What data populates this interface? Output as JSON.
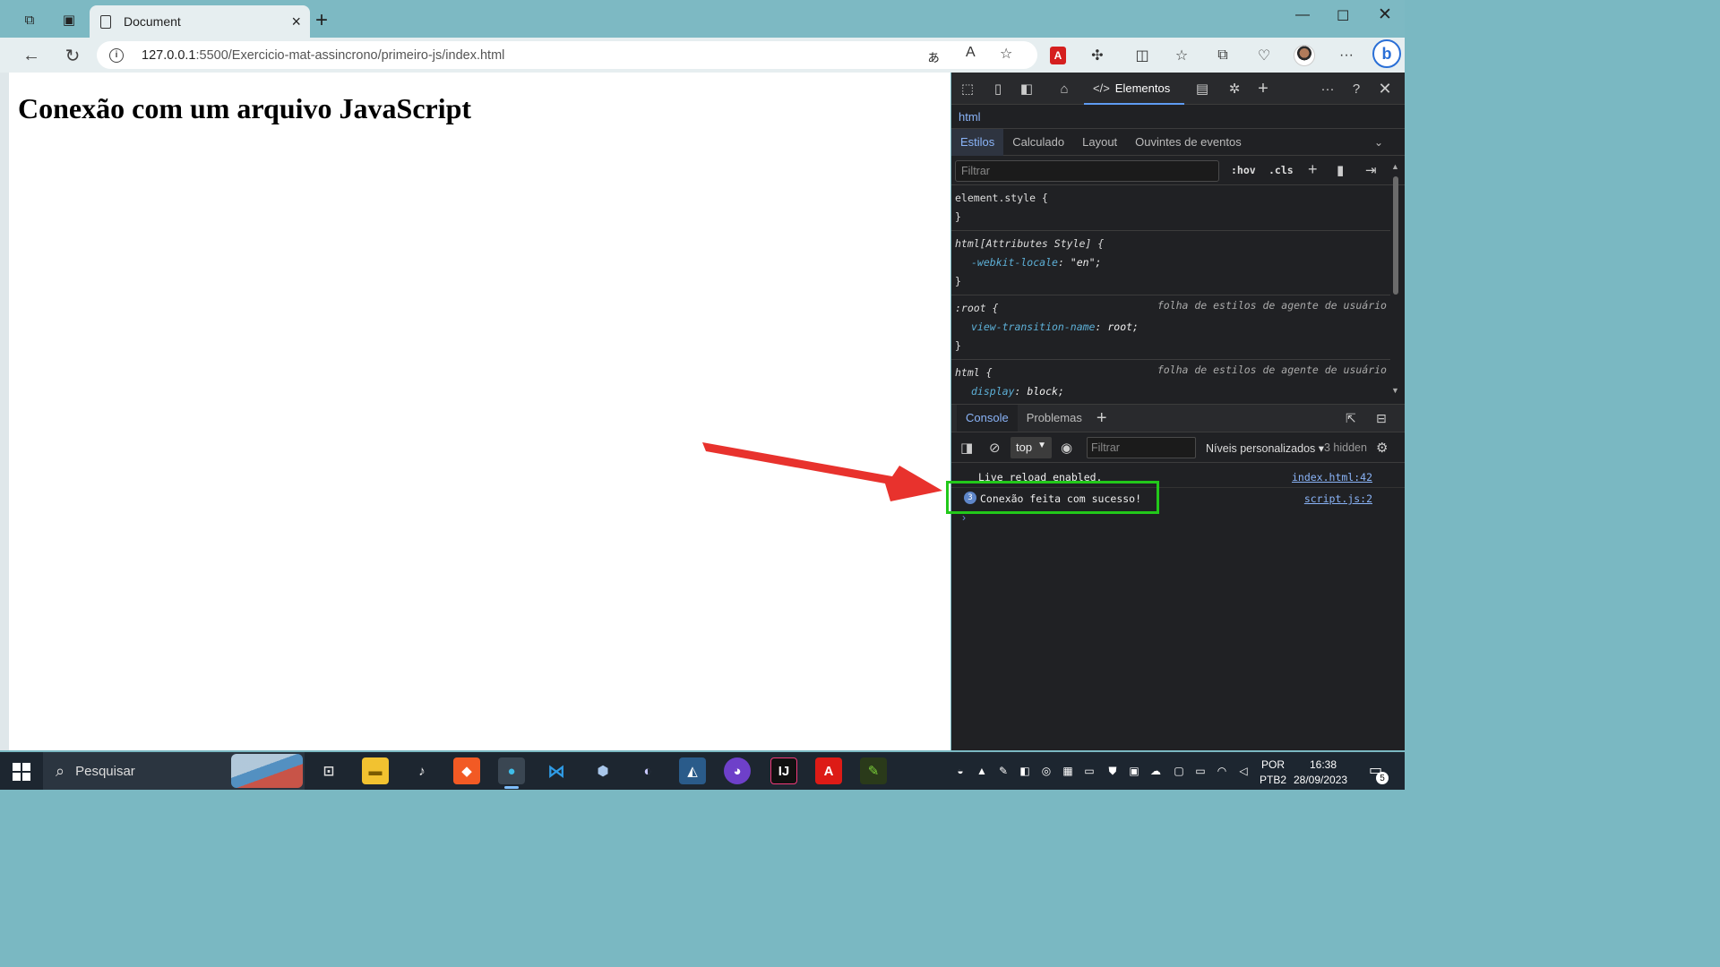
{
  "window": {
    "tab_title": "Document",
    "min_icon": "minimize-icon",
    "max_icon": "maximize-icon",
    "close_icon": "close-icon"
  },
  "address_bar": {
    "url_host": "127.0.0.1",
    "url_rest": ":5500/Exercicio-mat-assincrono/primeiro-js/index.html"
  },
  "page": {
    "heading": "Conexão com um arquivo JavaScript"
  },
  "devtools": {
    "main_tab": "Elementos",
    "breadcrumb": "html",
    "styles_tabs": [
      "Estilos",
      "Calculado",
      "Layout",
      "Ouvintes de eventos"
    ],
    "filter_placeholder": "Filtrar",
    "hov_label": ":hov",
    "cls_label": ".cls",
    "rules": [
      {
        "selector": "element.style {",
        "props": [],
        "close": "}",
        "source": ""
      },
      {
        "selector": "html[Attributes Style] {",
        "props": [
          {
            "name": "-webkit-locale",
            "value": "\"en\";"
          }
        ],
        "close": "}",
        "source": ""
      },
      {
        "selector": ":root {",
        "props": [
          {
            "name": "view-transition-name",
            "value": "root;"
          }
        ],
        "close": "}",
        "source": "folha de estilos de agente de usuário"
      },
      {
        "selector": "html {",
        "props": [
          {
            "name": "display",
            "value": "block;"
          }
        ],
        "close": "}",
        "source": "folha de estilos de agente de usuário"
      }
    ],
    "drawer_tabs": [
      "Console",
      "Problemas"
    ],
    "console": {
      "context": "top",
      "filter_placeholder": "Filtrar",
      "levels": "Níveis personalizados",
      "hidden": "3 hidden",
      "messages": [
        {
          "text": "Live reload enabled.",
          "source": "index.html:42",
          "count": ""
        },
        {
          "text": "Conexão feita com sucesso!",
          "source": "script.js:2",
          "count": "3"
        }
      ],
      "prompt": "›"
    }
  },
  "taskbar": {
    "search_label": "Pesquisar",
    "lang_1": "POR",
    "lang_2": "PTB2",
    "time": "16:38",
    "date": "28/09/2023",
    "notification_count": "5"
  },
  "colors": {
    "highlight_box": "#22c81a",
    "arrow": "#e8322d",
    "devtools_bg": "#202124"
  }
}
